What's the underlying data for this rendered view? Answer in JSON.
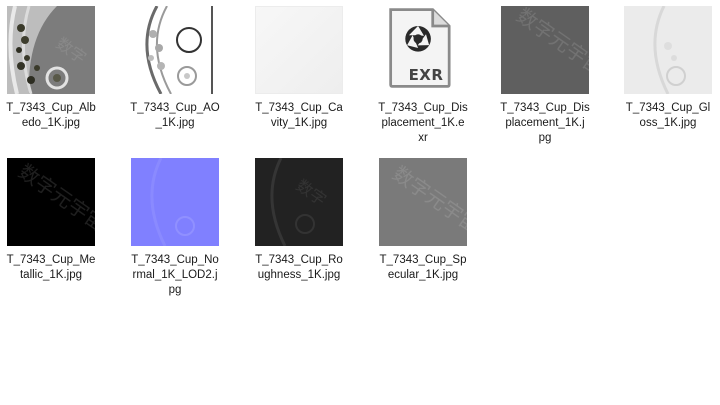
{
  "window": {
    "view": "large-icons"
  },
  "files": [
    {
      "name": "T_7343_Cup_Albedo_1K.jpg",
      "line1": "T_7343_Cup_Alb",
      "line2": "edo_1K.jpg",
      "line3": "",
      "thumb": "albedo"
    },
    {
      "name": "T_7343_Cup_AO_1K.jpg",
      "line1": "T_7343_Cup_AO",
      "line2": "_1K.jpg",
      "line3": "",
      "thumb": "ao"
    },
    {
      "name": "T_7343_Cup_Cavity_1K.jpg",
      "line1": "T_7343_Cup_Ca",
      "line2": "vity_1K.jpg",
      "line3": "",
      "thumb": "cavity"
    },
    {
      "name": "T_7343_Cup_Displacement_1K.exr",
      "line1": "T_7343_Cup_Dis",
      "line2": "placement_1K.e",
      "line3": "xr",
      "thumb": "exr",
      "icon_text": "EXR"
    },
    {
      "name": "T_7343_Cup_Displacement_1K.jpg",
      "line1": "T_7343_Cup_Dis",
      "line2": "placement_1K.j",
      "line3": "pg",
      "thumb": "displacement"
    },
    {
      "name": "T_7343_Cup_Gloss_1K.jpg",
      "line1": "T_7343_Cup_Gl",
      "line2": "oss_1K.jpg",
      "line3": "",
      "thumb": "gloss"
    },
    {
      "name": "T_7343_Cup_Metallic_1K.jpg",
      "line1": "T_7343_Cup_Me",
      "line2": "tallic_1K.jpg",
      "line3": "",
      "thumb": "metallic"
    },
    {
      "name": "T_7343_Cup_Normal_1K_LOD2.jpg",
      "line1": "T_7343_Cup_No",
      "line2": "rmal_1K_LOD2.j",
      "line3": "pg",
      "thumb": "normal"
    },
    {
      "name": "T_7343_Cup_Roughness_1K.jpg",
      "line1": "T_7343_Cup_Ro",
      "line2": "ughness_1K.jpg",
      "line3": "",
      "thumb": "roughness"
    },
    {
      "name": "T_7343_Cup_Specular_1K.jpg",
      "line1": "T_7343_Cup_Sp",
      "line2": "ecular_1K.jpg",
      "line3": "",
      "thumb": "specular"
    }
  ],
  "watermark": "数字元宇宙",
  "colors": {
    "background": "#ffffff",
    "label_text": "#1a1a1a",
    "normal_map": "#8080ff",
    "exr_icon": "#444444"
  }
}
